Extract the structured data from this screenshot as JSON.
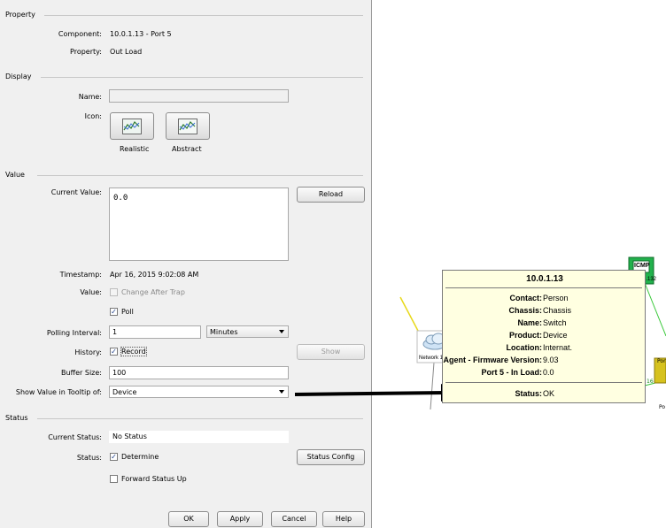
{
  "sections": {
    "property": "Property",
    "display": "Display",
    "value": "Value",
    "status": "Status"
  },
  "property": {
    "component_label": "Component:",
    "component_value": "10.0.1.13 - Port 5",
    "property_label": "Property:",
    "property_value": "Out Load"
  },
  "display": {
    "name_label": "Name:",
    "name_value": "",
    "icon_label": "Icon:",
    "icon_realistic": "Realistic",
    "icon_abstract": "Abstract"
  },
  "value": {
    "current_value_label": "Current Value:",
    "current_value": "0.0",
    "reload_button": "Reload",
    "timestamp_label": "Timestamp:",
    "timestamp_value": "Apr 16, 2015 9:02:08 AM",
    "value_label": "Value:",
    "change_after_trap": "Change After Trap",
    "change_after_trap_checked": false,
    "poll": "Poll",
    "poll_checked": true,
    "polling_interval_label": "Polling Interval:",
    "polling_interval_value": "1",
    "polling_unit": "Minutes",
    "history_label": "History:",
    "record": "Record",
    "record_checked": true,
    "show_button": "Show",
    "buffer_size_label": "Buffer Size:",
    "buffer_size_value": "100",
    "tooltip_of_label": "Show Value in Tooltip of:",
    "tooltip_of_value": "Device"
  },
  "status": {
    "current_status_label": "Current Status:",
    "current_status_value": "No Status",
    "status_label": "Status:",
    "determine": "Determine",
    "determine_checked": true,
    "status_config_button": "Status Config",
    "forward_status_up": "Forward Status Up",
    "forward_checked": false
  },
  "buttons": {
    "ok": "OK",
    "apply": "Apply",
    "cancel": "Cancel",
    "help": "Help"
  },
  "tooltip": {
    "title": "10.0.1.13",
    "rows": [
      {
        "key": "Contact:",
        "value": "Person"
      },
      {
        "key": "Chassis:",
        "value": "Chassis"
      },
      {
        "key": "Name:",
        "value": "Switch"
      },
      {
        "key": "Product:",
        "value": "Device"
      },
      {
        "key": "Location:",
        "value": "Internat."
      },
      {
        "key": "Agent - Firmware Version:",
        "value": "9.03"
      },
      {
        "key": "Port 5 - In Load:",
        "value": "0.0"
      }
    ],
    "status_key": "Status:",
    "status_value": "OK"
  },
  "map": {
    "network_label": "Network 1",
    "icmp_label": "ICMP",
    "icmp_sub": "1.132",
    "edge_label": "16",
    "port_label_1": "Por",
    "port_label_2": "Po"
  },
  "colors": {
    "dialog_bg": "#f0f0f0",
    "tooltip_bg": "#ffffe1",
    "icmp_green": "#22b14c",
    "link_yellow": "#e8d81a",
    "link_green": "#38c838"
  },
  "icons": {
    "realistic": "line-chart-icon",
    "abstract": "line-chart-icon",
    "network": "cloud-icon",
    "arrow": "arrow-right-icon"
  }
}
